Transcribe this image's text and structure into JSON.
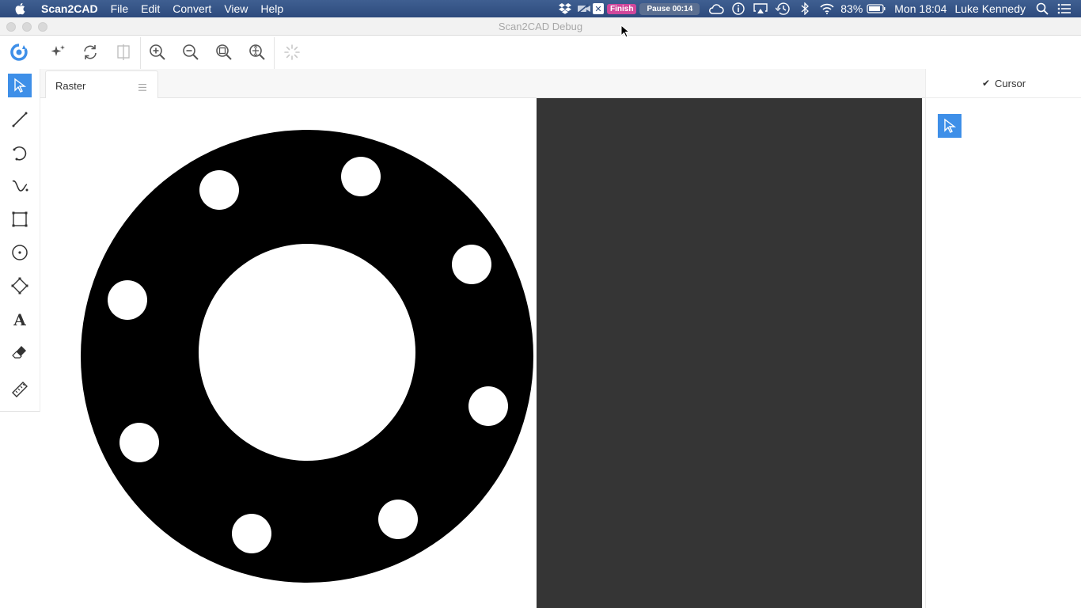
{
  "menubar": {
    "app_name": "Scan2CAD",
    "items": [
      "File",
      "Edit",
      "Convert",
      "View",
      "Help"
    ],
    "finish_label": "Finish",
    "pause_label": "Pause 00:14",
    "battery": "83%",
    "clock": "Mon 18:04",
    "user": "Luke Kennedy"
  },
  "window": {
    "title": "Scan2CAD Debug"
  },
  "tabs": [
    {
      "label": "Raster"
    }
  ],
  "right_panel": {
    "title": "Cursor"
  },
  "colors": {
    "accent": "#3e8fe8",
    "dark_panel": "#353535",
    "finish_badge": "#d0479b"
  }
}
